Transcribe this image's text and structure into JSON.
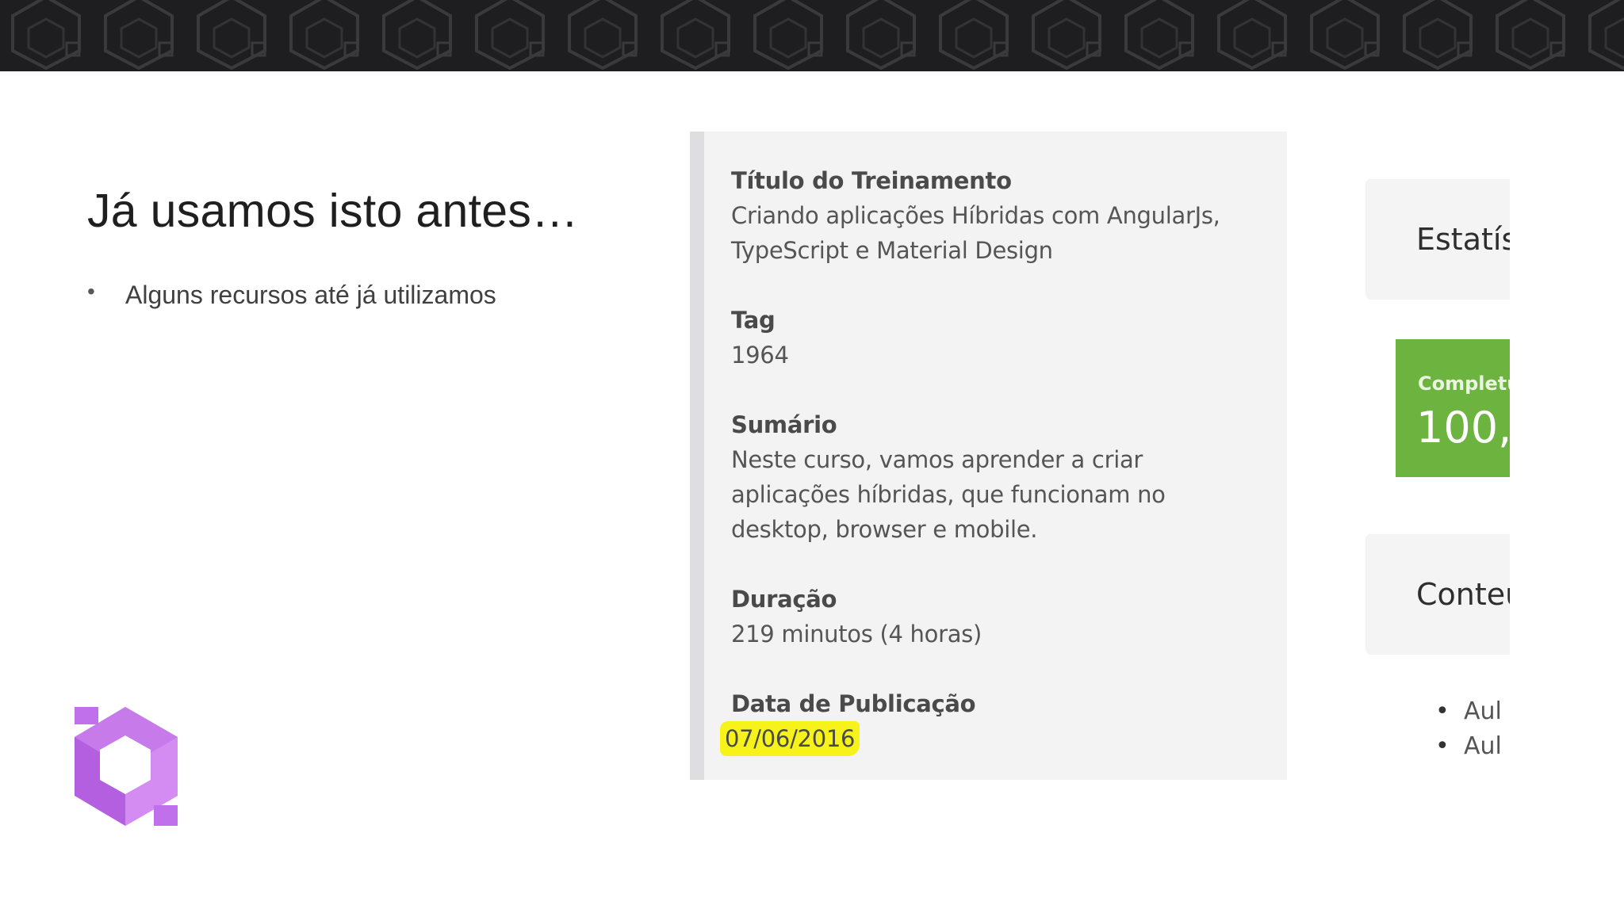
{
  "slide": {
    "title": "Já usamos isto antes…",
    "bullets": [
      "Alguns recursos até já utilizamos"
    ]
  },
  "screenshot": {
    "fields": [
      {
        "label": "Título do Treinamento",
        "value_lines": [
          "Criando aplicações Híbridas com AngularJs,",
          "TypeScript e Material Design"
        ]
      },
      {
        "label": "Tag",
        "value_lines": [
          "1964"
        ]
      },
      {
        "label": "Sumário",
        "value_lines": [
          "Neste curso, vamos aprender a criar",
          "aplicações híbridas, que funcionam no",
          "desktop, browser e mobile."
        ]
      },
      {
        "label": "Duração",
        "value_lines": [
          "219 minutos (4 horas)"
        ]
      },
      {
        "label": "Data de Publicação",
        "value_lines": [
          "07/06/2016"
        ]
      }
    ],
    "highlight_color": "#f7f31a"
  },
  "side_panel": {
    "stats_title": "Estatís",
    "completion_label": "Completu",
    "completion_value": "100,(",
    "content_title": "Conteu",
    "lessons": [
      "Aul",
      "Aul"
    ],
    "completion_color": "#6db33f"
  },
  "colors": {
    "banner": "#1e1e20",
    "logo_purple": "#b45fe0"
  }
}
